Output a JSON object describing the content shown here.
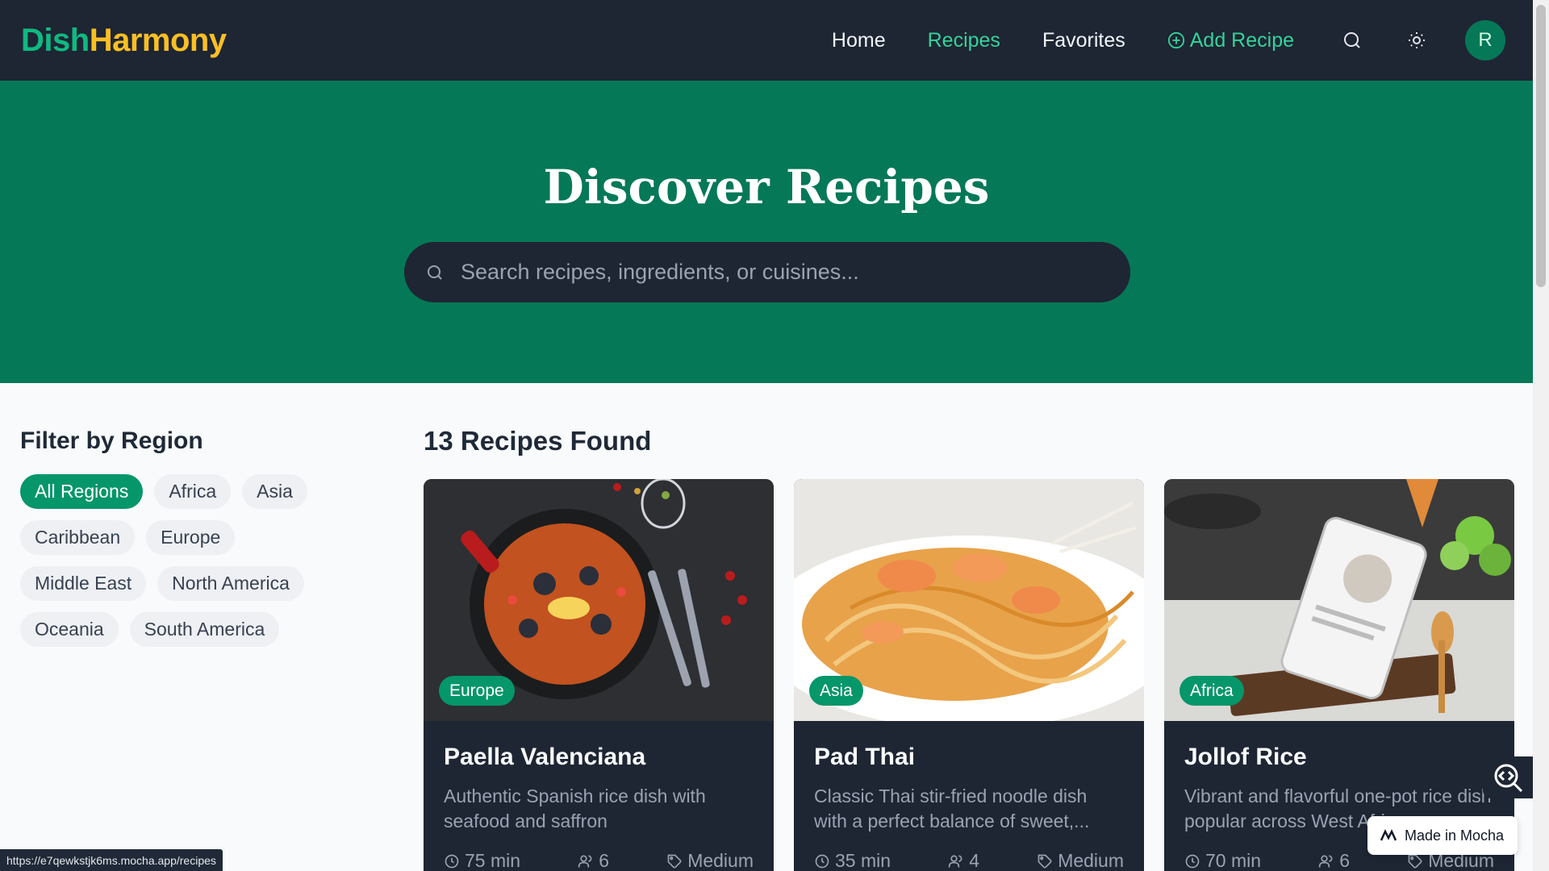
{
  "brand": {
    "part1": "Dish",
    "part2": "Harmony"
  },
  "nav": {
    "home": "Home",
    "recipes": "Recipes",
    "favorites": "Favorites",
    "add_recipe": "Add Recipe",
    "avatar_initial": "R"
  },
  "hero": {
    "title": "Discover Recipes",
    "search_placeholder": "Search recipes, ingredients, or cuisines..."
  },
  "filter": {
    "title": "Filter by Region",
    "regions": [
      "All Regions",
      "Africa",
      "Asia",
      "Caribbean",
      "Europe",
      "Middle East",
      "North America",
      "Oceania",
      "South America"
    ],
    "selected": "All Regions"
  },
  "results": {
    "title": "13 Recipes Found",
    "cards": [
      {
        "region": "Europe",
        "title": "Paella Valenciana",
        "description": "Authentic Spanish rice dish with seafood and saffron",
        "time": "75 min",
        "servings": "6",
        "difficulty": "Medium"
      },
      {
        "region": "Asia",
        "title": "Pad Thai",
        "description": "Classic Thai stir-fried noodle dish with a perfect balance of sweet,...",
        "time": "35 min",
        "servings": "4",
        "difficulty": "Medium"
      },
      {
        "region": "Africa",
        "title": "Jollof Rice",
        "description": "Vibrant and flavorful one-pot rice dish popular across West Africa",
        "time": "70 min",
        "servings": "6",
        "difficulty": "Medium"
      }
    ]
  },
  "status_url": "https://e7qewkstjk6ms.mocha.app/recipes",
  "badge": {
    "label": "Made in Mocha"
  },
  "colors": {
    "accent": "#059669",
    "hero": "#047857",
    "nav": "#1e2533",
    "brand_yellow": "#fbbf24",
    "brand_green": "#10b981"
  }
}
